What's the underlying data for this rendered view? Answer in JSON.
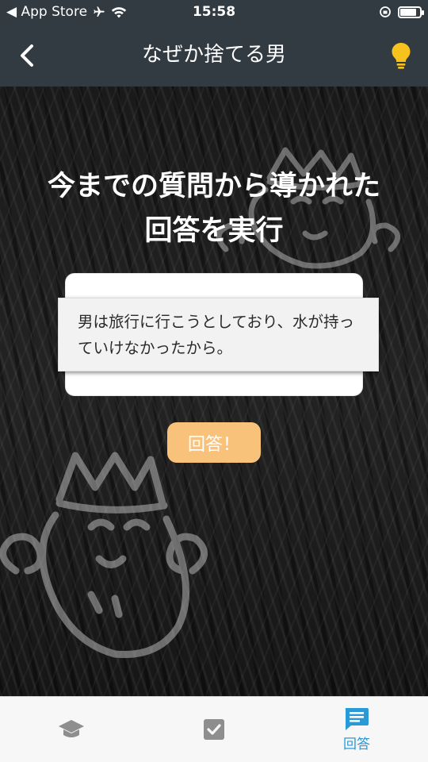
{
  "status_bar": {
    "carrier_back": "◀ App Store",
    "time": "15:58",
    "battery_level": 0.85
  },
  "nav": {
    "title": "なぜか捨てる男",
    "back_icon": "chevron-left-icon",
    "hint_icon": "lightbulb-icon",
    "hint_color": "#f7c21d"
  },
  "main": {
    "heading_line1": "今までの質問から導かれた",
    "heading_line2": "回答を実行",
    "answer_text": "男は旅行に行こうとしており、水が持っていけなかったから。",
    "submit_label": "回答！",
    "submit_color": "#f9c27b"
  },
  "tab_bar": {
    "tabs": [
      {
        "icon": "graduation-cap-icon",
        "label": "",
        "active": false
      },
      {
        "icon": "checkbox-icon",
        "label": "",
        "active": false
      },
      {
        "icon": "chat-icon",
        "label": "回答",
        "active": true
      }
    ],
    "active_color": "#2a9ad6",
    "inactive_color": "#8e8e8e"
  }
}
